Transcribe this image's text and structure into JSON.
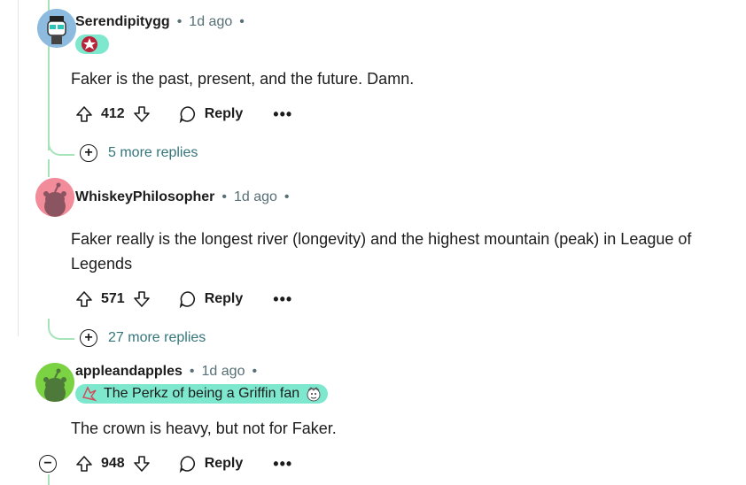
{
  "comments": [
    {
      "username": "Serendipitygg",
      "time": "1d ago",
      "body": "Faker is the past, present, and the future. Damn.",
      "score": "412",
      "reply_label": "Reply",
      "more_replies": "5 more replies"
    },
    {
      "username": "WhiskeyPhilosopher",
      "time": "1d ago",
      "body": "Faker really is the longest river (longevity) and the highest mountain (peak) in League of Legends",
      "score": "571",
      "reply_label": "Reply",
      "more_replies": "27 more replies"
    },
    {
      "username": "appleandapples",
      "time": "1d ago",
      "flair": "The Perkz of being a Griffin fan",
      "body": "The crown is heavy, but not for Faker.",
      "score": "948",
      "reply_label": "Reply"
    }
  ],
  "separator": "•",
  "colors": {
    "accent": "#7ee8cf",
    "thread": "#a7e3b8",
    "link": "#33757a"
  }
}
